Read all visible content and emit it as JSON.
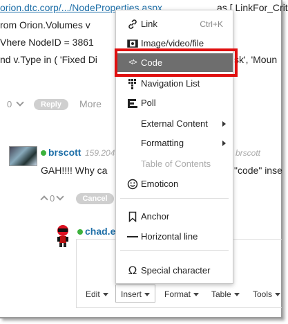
{
  "background": {
    "url_line": "orion.dtc.corp/.../NodeProperties.aspx",
    "url_rest": "as [ LinkFor_Critica",
    "sql_line2": "rom Orion.Volumes v",
    "sql_line3": "Vhere NodeID = 3861",
    "sql_line4_a": "nd v.Type in ( 'Fixed Di",
    "sql_line4_b": "sk', 'Moun"
  },
  "post1_actions": {
    "vote_count": "0",
    "reply_label": "Reply",
    "more_label": "More"
  },
  "comment": {
    "username": "brscott",
    "meta_ip": "159.204",
    "meta_user": "brscott",
    "text_a": "GAH!!!!   Why ca",
    "text_b": "\"code\" inse",
    "vote_count": "0",
    "cancel_label": "Cancel"
  },
  "reply_user": {
    "username": "chad.ev"
  },
  "editor_toolbar": {
    "edit": "Edit",
    "insert": "Insert",
    "format": "Format",
    "table": "Table",
    "tools": "Tools"
  },
  "insert_menu": {
    "items": [
      {
        "label": "Link",
        "shortcut": "Ctrl+K",
        "icon": "link-icon"
      },
      {
        "label": "Image/video/file",
        "icon": "media-icon"
      },
      {
        "label": "Code",
        "icon": "code-icon"
      },
      {
        "label": "Navigation List",
        "icon": "navigation-list-icon"
      },
      {
        "label": "Poll",
        "icon": "poll-icon"
      },
      {
        "label": "External Content"
      },
      {
        "label": "Formatting"
      },
      {
        "label": "Table of Contents"
      },
      {
        "label": "Emoticon",
        "icon": "emoticon-icon"
      },
      {
        "label": "Anchor",
        "icon": "anchor-icon"
      },
      {
        "label": "Horizontal line",
        "icon": "horizontal-line-icon"
      },
      {
        "label": "Special character",
        "icon": "omega-icon"
      }
    ]
  },
  "colors": {
    "highlight_border": "#e01010",
    "code_item_bg": "#6e6e6e",
    "online_dot": "#3db23d",
    "username": "#1e6fa8"
  }
}
